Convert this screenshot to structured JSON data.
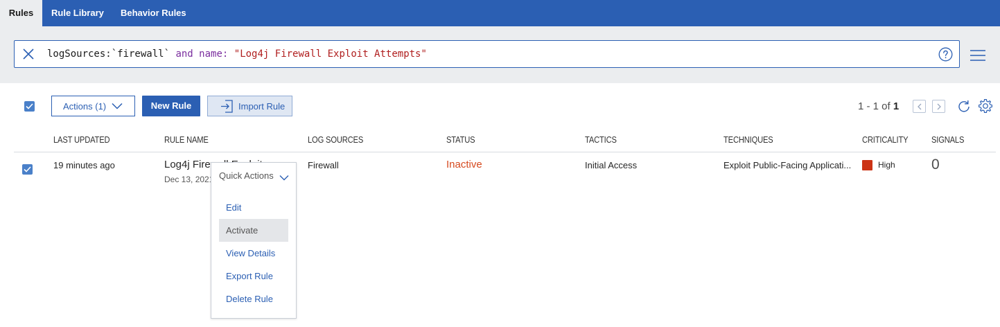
{
  "tabs": [
    {
      "label": "Rules",
      "active": true
    },
    {
      "label": "Rule Library",
      "active": false
    },
    {
      "label": "Behavior Rules",
      "active": false
    }
  ],
  "search": {
    "query_tokens": [
      {
        "text": "logSources:",
        "kind": "field"
      },
      {
        "text": "`firewall`",
        "kind": "field"
      },
      {
        "text": " and ",
        "kind": "operator"
      },
      {
        "text": "name:",
        "kind": "operator"
      },
      {
        "text": " ",
        "kind": "field"
      },
      {
        "text": "\"Log4j Firewall Exploit Attempts\"",
        "kind": "string"
      }
    ]
  },
  "toolbar": {
    "actions_label": "Actions (1)",
    "new_rule_label": "New Rule",
    "import_rule_label": "Import Rule",
    "pager": {
      "range": "1 - 1 of ",
      "total": "1"
    }
  },
  "table": {
    "columns": [
      "Last Updated",
      "Rule Name",
      "Log Sources",
      "Status",
      "Tactics",
      "Techniques",
      "Criticality",
      "Signals"
    ],
    "rows": [
      {
        "selected": true,
        "last_updated": "19 minutes ago",
        "rule_name": "Log4j Firewall Exploit",
        "rule_date": "Dec 13, 2021",
        "log_sources": "Firewall",
        "status": "Inactive",
        "tactics": "Initial Access",
        "techniques": "Exploit Public-Facing Applicati...",
        "criticality": "High",
        "criticality_color": "#cc3315",
        "signals": "0"
      }
    ]
  },
  "quick_actions": {
    "label": "Quick Actions",
    "items": [
      "Edit",
      "Activate",
      "View Details",
      "Export Rule",
      "Delete Rule"
    ],
    "hovered": "Activate"
  },
  "icons": {
    "clear": "close-icon",
    "help": "help-circle-icon",
    "menu": "hamburger-menu-icon",
    "chevron": "chevron-down-icon",
    "import": "import-icon",
    "refresh": "refresh-icon",
    "settings": "gear-icon"
  },
  "colors": {
    "brand": "#2b5fb3",
    "status_inactive": "#d64a1f",
    "criticality_high": "#cc3315"
  }
}
